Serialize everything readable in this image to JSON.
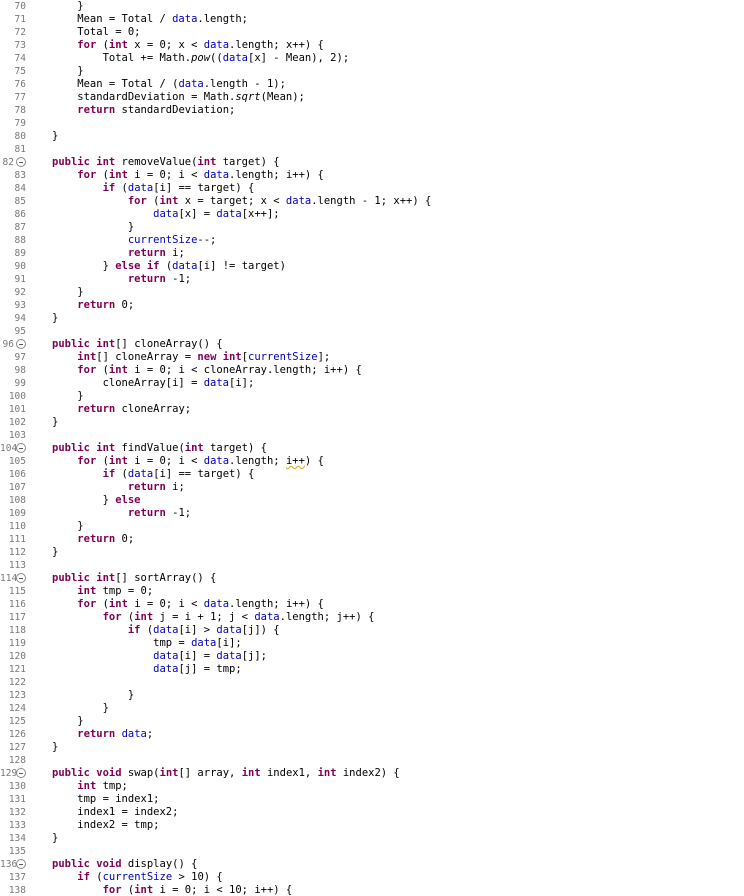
{
  "editor": {
    "language": "java",
    "colors": {
      "keyword": "#7f0055",
      "field": "#0000c0",
      "line_number": "#787878"
    },
    "lines": [
      {
        "num": "70",
        "tokens": [
          {
            "t": "    }"
          }
        ]
      },
      {
        "num": "71",
        "tokens": [
          {
            "t": "    Mean = Total / "
          },
          {
            "t": "data",
            "c": "fld"
          },
          {
            "t": ".length;"
          }
        ]
      },
      {
        "num": "72",
        "tokens": [
          {
            "t": "    Total = 0;"
          }
        ]
      },
      {
        "num": "73",
        "tokens": [
          {
            "t": "    "
          },
          {
            "t": "for",
            "c": "kw"
          },
          {
            "t": " ("
          },
          {
            "t": "int",
            "c": "kw"
          },
          {
            "t": " x = 0; x < "
          },
          {
            "t": "data",
            "c": "fld"
          },
          {
            "t": ".length; x++) {"
          }
        ]
      },
      {
        "num": "74",
        "tokens": [
          {
            "t": "        Total += Math."
          },
          {
            "t": "pow",
            "c": "italic"
          },
          {
            "t": "(("
          },
          {
            "t": "data",
            "c": "fld"
          },
          {
            "t": "[x] - Mean), 2);"
          }
        ]
      },
      {
        "num": "75",
        "tokens": [
          {
            "t": "    }"
          }
        ]
      },
      {
        "num": "76",
        "tokens": [
          {
            "t": "    Mean = Total / ("
          },
          {
            "t": "data",
            "c": "fld"
          },
          {
            "t": ".length - 1);"
          }
        ]
      },
      {
        "num": "77",
        "tokens": [
          {
            "t": "    standardDeviation = Math."
          },
          {
            "t": "sqrt",
            "c": "italic"
          },
          {
            "t": "(Mean);"
          }
        ]
      },
      {
        "num": "78",
        "tokens": [
          {
            "t": "    "
          },
          {
            "t": "return",
            "c": "kw"
          },
          {
            "t": " standardDeviation;"
          }
        ]
      },
      {
        "num": "79",
        "tokens": []
      },
      {
        "num": "80",
        "tokens": [
          {
            "t": "}"
          }
        ]
      },
      {
        "num": "81",
        "tokens": []
      },
      {
        "num": "82",
        "fold": true,
        "tokens": [
          {
            "t": "public",
            "c": "kw"
          },
          {
            "t": " "
          },
          {
            "t": "int",
            "c": "kw"
          },
          {
            "t": " removeValue("
          },
          {
            "t": "int",
            "c": "kw"
          },
          {
            "t": " target) {"
          }
        ]
      },
      {
        "num": "83",
        "tokens": [
          {
            "t": "    "
          },
          {
            "t": "for",
            "c": "kw"
          },
          {
            "t": " ("
          },
          {
            "t": "int",
            "c": "kw"
          },
          {
            "t": " i = 0; i < "
          },
          {
            "t": "data",
            "c": "fld"
          },
          {
            "t": ".length; i++) {"
          }
        ]
      },
      {
        "num": "84",
        "tokens": [
          {
            "t": "        "
          },
          {
            "t": "if",
            "c": "kw"
          },
          {
            "t": " ("
          },
          {
            "t": "data",
            "c": "fld"
          },
          {
            "t": "[i] == target) {"
          }
        ]
      },
      {
        "num": "85",
        "tokens": [
          {
            "t": "            "
          },
          {
            "t": "for",
            "c": "kw"
          },
          {
            "t": " ("
          },
          {
            "t": "int",
            "c": "kw"
          },
          {
            "t": " x = target; x < "
          },
          {
            "t": "data",
            "c": "fld"
          },
          {
            "t": ".length - 1; x++) {"
          }
        ]
      },
      {
        "num": "86",
        "tokens": [
          {
            "t": "                "
          },
          {
            "t": "data",
            "c": "fld"
          },
          {
            "t": "[x] = "
          },
          {
            "t": "data",
            "c": "fld"
          },
          {
            "t": "[x++];"
          }
        ]
      },
      {
        "num": "87",
        "tokens": [
          {
            "t": "            }"
          }
        ]
      },
      {
        "num": "88",
        "tokens": [
          {
            "t": "            "
          },
          {
            "t": "currentSize",
            "c": "fld"
          },
          {
            "t": "--;"
          }
        ]
      },
      {
        "num": "89",
        "tokens": [
          {
            "t": "            "
          },
          {
            "t": "return",
            "c": "kw"
          },
          {
            "t": " i;"
          }
        ]
      },
      {
        "num": "90",
        "tokens": [
          {
            "t": "        } "
          },
          {
            "t": "else",
            "c": "kw"
          },
          {
            "t": " "
          },
          {
            "t": "if",
            "c": "kw"
          },
          {
            "t": " ("
          },
          {
            "t": "data",
            "c": "fld"
          },
          {
            "t": "[i] != target)"
          }
        ]
      },
      {
        "num": "91",
        "tokens": [
          {
            "t": "            "
          },
          {
            "t": "return",
            "c": "kw"
          },
          {
            "t": " -1;"
          }
        ]
      },
      {
        "num": "92",
        "tokens": [
          {
            "t": "    }"
          }
        ]
      },
      {
        "num": "93",
        "tokens": [
          {
            "t": "    "
          },
          {
            "t": "return",
            "c": "kw"
          },
          {
            "t": " 0;"
          }
        ]
      },
      {
        "num": "94",
        "tokens": [
          {
            "t": "}"
          }
        ]
      },
      {
        "num": "95",
        "tokens": []
      },
      {
        "num": "96",
        "fold": true,
        "tokens": [
          {
            "t": "public",
            "c": "kw"
          },
          {
            "t": " "
          },
          {
            "t": "int",
            "c": "kw"
          },
          {
            "t": "[] cloneArray() {"
          }
        ]
      },
      {
        "num": "97",
        "tokens": [
          {
            "t": "    "
          },
          {
            "t": "int",
            "c": "kw"
          },
          {
            "t": "[] cloneArray = "
          },
          {
            "t": "new",
            "c": "kw"
          },
          {
            "t": " "
          },
          {
            "t": "int",
            "c": "kw"
          },
          {
            "t": "["
          },
          {
            "t": "currentSize",
            "c": "fld"
          },
          {
            "t": "];"
          }
        ]
      },
      {
        "num": "98",
        "tokens": [
          {
            "t": "    "
          },
          {
            "t": "for",
            "c": "kw"
          },
          {
            "t": " ("
          },
          {
            "t": "int",
            "c": "kw"
          },
          {
            "t": " i = 0; i < cloneArray.length; i++) {"
          }
        ]
      },
      {
        "num": "99",
        "tokens": [
          {
            "t": "        cloneArray[i] = "
          },
          {
            "t": "data",
            "c": "fld"
          },
          {
            "t": "[i];"
          }
        ]
      },
      {
        "num": "100",
        "tokens": [
          {
            "t": "    }"
          }
        ]
      },
      {
        "num": "101",
        "tokens": [
          {
            "t": "    "
          },
          {
            "t": "return",
            "c": "kw"
          },
          {
            "t": " cloneArray;"
          }
        ]
      },
      {
        "num": "102",
        "tokens": [
          {
            "t": "}"
          }
        ]
      },
      {
        "num": "103",
        "tokens": []
      },
      {
        "num": "104",
        "fold": true,
        "tokens": [
          {
            "t": "public",
            "c": "kw"
          },
          {
            "t": " "
          },
          {
            "t": "int",
            "c": "kw"
          },
          {
            "t": " findValue("
          },
          {
            "t": "int",
            "c": "kw"
          },
          {
            "t": " target) {"
          }
        ]
      },
      {
        "num": "105",
        "tokens": [
          {
            "t": "    "
          },
          {
            "t": "for",
            "c": "kw"
          },
          {
            "t": " ("
          },
          {
            "t": "int",
            "c": "kw"
          },
          {
            "t": " i = 0; i < "
          },
          {
            "t": "data",
            "c": "fld"
          },
          {
            "t": ".length; "
          },
          {
            "t": "i++",
            "c": "squiggle"
          },
          {
            "t": ") {"
          }
        ]
      },
      {
        "num": "106",
        "tokens": [
          {
            "t": "        "
          },
          {
            "t": "if",
            "c": "kw"
          },
          {
            "t": " ("
          },
          {
            "t": "data",
            "c": "fld"
          },
          {
            "t": "[i] == target) {"
          }
        ]
      },
      {
        "num": "107",
        "tokens": [
          {
            "t": "            "
          },
          {
            "t": "return",
            "c": "kw"
          },
          {
            "t": " i;"
          }
        ]
      },
      {
        "num": "108",
        "tokens": [
          {
            "t": "        } "
          },
          {
            "t": "else",
            "c": "kw"
          }
        ]
      },
      {
        "num": "109",
        "tokens": [
          {
            "t": "            "
          },
          {
            "t": "return",
            "c": "kw"
          },
          {
            "t": " -1;"
          }
        ]
      },
      {
        "num": "110",
        "tokens": [
          {
            "t": "    }"
          }
        ]
      },
      {
        "num": "111",
        "tokens": [
          {
            "t": "    "
          },
          {
            "t": "return",
            "c": "kw"
          },
          {
            "t": " 0;"
          }
        ]
      },
      {
        "num": "112",
        "tokens": [
          {
            "t": "}"
          }
        ]
      },
      {
        "num": "113",
        "tokens": []
      },
      {
        "num": "114",
        "fold": true,
        "tokens": [
          {
            "t": "public",
            "c": "kw"
          },
          {
            "t": " "
          },
          {
            "t": "int",
            "c": "kw"
          },
          {
            "t": "[] sortArray() {"
          }
        ]
      },
      {
        "num": "115",
        "tokens": [
          {
            "t": "    "
          },
          {
            "t": "int",
            "c": "kw"
          },
          {
            "t": " tmp = 0;"
          }
        ]
      },
      {
        "num": "116",
        "tokens": [
          {
            "t": "    "
          },
          {
            "t": "for",
            "c": "kw"
          },
          {
            "t": " ("
          },
          {
            "t": "int",
            "c": "kw"
          },
          {
            "t": " i = 0; i < "
          },
          {
            "t": "data",
            "c": "fld"
          },
          {
            "t": ".length; i++) {"
          }
        ]
      },
      {
        "num": "117",
        "tokens": [
          {
            "t": "        "
          },
          {
            "t": "for",
            "c": "kw"
          },
          {
            "t": " ("
          },
          {
            "t": "int",
            "c": "kw"
          },
          {
            "t": " j = i + 1; j < "
          },
          {
            "t": "data",
            "c": "fld"
          },
          {
            "t": ".length; j++) {"
          }
        ]
      },
      {
        "num": "118",
        "tokens": [
          {
            "t": "            "
          },
          {
            "t": "if",
            "c": "kw"
          },
          {
            "t": " ("
          },
          {
            "t": "data",
            "c": "fld"
          },
          {
            "t": "[i] > "
          },
          {
            "t": "data",
            "c": "fld"
          },
          {
            "t": "[j]) {"
          }
        ]
      },
      {
        "num": "119",
        "tokens": [
          {
            "t": "                tmp = "
          },
          {
            "t": "data",
            "c": "fld"
          },
          {
            "t": "[i];"
          }
        ]
      },
      {
        "num": "120",
        "tokens": [
          {
            "t": "                "
          },
          {
            "t": "data",
            "c": "fld"
          },
          {
            "t": "[i] = "
          },
          {
            "t": "data",
            "c": "fld"
          },
          {
            "t": "[j];"
          }
        ]
      },
      {
        "num": "121",
        "tokens": [
          {
            "t": "                "
          },
          {
            "t": "data",
            "c": "fld"
          },
          {
            "t": "[j] = tmp;"
          }
        ]
      },
      {
        "num": "122",
        "tokens": []
      },
      {
        "num": "123",
        "tokens": [
          {
            "t": "            }"
          }
        ]
      },
      {
        "num": "124",
        "tokens": [
          {
            "t": "        }"
          }
        ]
      },
      {
        "num": "125",
        "tokens": [
          {
            "t": "    }"
          }
        ]
      },
      {
        "num": "126",
        "tokens": [
          {
            "t": "    "
          },
          {
            "t": "return",
            "c": "kw"
          },
          {
            "t": " "
          },
          {
            "t": "data",
            "c": "fld"
          },
          {
            "t": ";"
          }
        ]
      },
      {
        "num": "127",
        "tokens": [
          {
            "t": "}"
          }
        ]
      },
      {
        "num": "128",
        "tokens": []
      },
      {
        "num": "129",
        "fold": true,
        "tokens": [
          {
            "t": "public",
            "c": "kw"
          },
          {
            "t": " "
          },
          {
            "t": "void",
            "c": "kw"
          },
          {
            "t": " swap("
          },
          {
            "t": "int",
            "c": "kw"
          },
          {
            "t": "[] array, "
          },
          {
            "t": "int",
            "c": "kw"
          },
          {
            "t": " index1, "
          },
          {
            "t": "int",
            "c": "kw"
          },
          {
            "t": " index2) {"
          }
        ]
      },
      {
        "num": "130",
        "tokens": [
          {
            "t": "    "
          },
          {
            "t": "int",
            "c": "kw"
          },
          {
            "t": " tmp;"
          }
        ]
      },
      {
        "num": "131",
        "tokens": [
          {
            "t": "    tmp = index1;"
          }
        ]
      },
      {
        "num": "132",
        "tokens": [
          {
            "t": "    index1 = index2;"
          }
        ]
      },
      {
        "num": "133",
        "tokens": [
          {
            "t": "    index2 = tmp;"
          }
        ]
      },
      {
        "num": "134",
        "tokens": [
          {
            "t": "}"
          }
        ]
      },
      {
        "num": "135",
        "tokens": []
      },
      {
        "num": "136",
        "fold": true,
        "tokens": [
          {
            "t": "public",
            "c": "kw"
          },
          {
            "t": " "
          },
          {
            "t": "void",
            "c": "kw"
          },
          {
            "t": " display() {"
          }
        ]
      },
      {
        "num": "137",
        "tokens": [
          {
            "t": "    "
          },
          {
            "t": "if",
            "c": "kw"
          },
          {
            "t": " ("
          },
          {
            "t": "currentSize",
            "c": "fld"
          },
          {
            "t": " > 10) {"
          }
        ]
      },
      {
        "num": "138",
        "tokens": [
          {
            "t": "        "
          },
          {
            "t": "for",
            "c": "kw"
          },
          {
            "t": " ("
          },
          {
            "t": "int",
            "c": "kw"
          },
          {
            "t": " i = 0; i < 10; i++) {"
          }
        ]
      }
    ]
  }
}
